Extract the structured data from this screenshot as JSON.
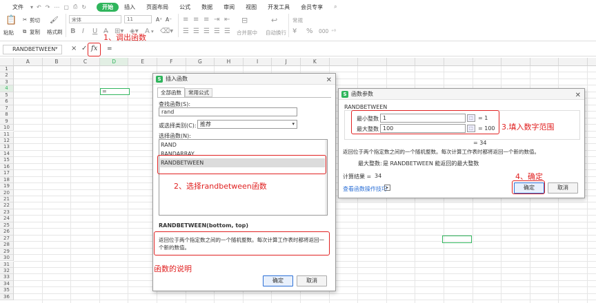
{
  "ribbon": {
    "menu": [
      "文件",
      "开始",
      "插入",
      "页面布局",
      "公式",
      "数据",
      "审阅",
      "视图",
      "开发工具",
      "会员专享"
    ],
    "cut": "剪切",
    "copy": "复制",
    "paste": "粘贴",
    "format_painter": "格式刷",
    "font_name": "宋体",
    "font_size": "11",
    "merge_center": "合并居中",
    "auto_wrap": "自动换行",
    "number_format": "常规",
    "percent": "%",
    "thousands": "000",
    "bold": "B",
    "italic": "I",
    "underline": "U",
    "font_color_glyph": "A"
  },
  "formula_bar": {
    "name_box": "RANDBETWEEN",
    "cancel": "×",
    "confirm": "✓",
    "fx": "fx",
    "content": "="
  },
  "grid": {
    "columns": [
      "A",
      "B",
      "C",
      "D",
      "E",
      "F",
      "G",
      "H",
      "I",
      "J",
      "K"
    ],
    "active_cell_value": "=",
    "active_row": "4",
    "active_col": "D"
  },
  "insert_dialog": {
    "title": "插入函数",
    "tab_all": "全部函数",
    "tab_common": "常用公式",
    "search_label": "查找函数(S):",
    "search_value": "rand",
    "category_label": "或选择类别(C):",
    "category_value": "推荐",
    "list_label": "选择函数(N):",
    "functions": [
      "RAND",
      "RANDARRAY",
      "RANDBETWEEN"
    ],
    "signature": "RANDBETWEEN(bottom, top)",
    "description": "返回位于两个指定数之间的一个随机整数。每次计算工作表时都将返回一个新的数值。",
    "ok": "确定",
    "cancel": "取消"
  },
  "args_dialog": {
    "title": "函数参数",
    "func_name": "RANDBETWEEN",
    "min_label": "最小整数",
    "min_value": "1",
    "min_result": "= 1",
    "max_label": "最大整数",
    "max_value": "100",
    "max_result": "= 100",
    "sample_result": "= 34",
    "description": "返回位于两个指定数之间的一个随机整数。每次计算工作表时都将返回一个新的数值。",
    "param_desc_label": "最大整数:",
    "param_desc": "是 RANDBETWEEN 能返回的最大整数",
    "calc_result_label": "计算结果 =",
    "calc_result_value": "34",
    "tips_link": "查看函数操作技巧",
    "ok": "确定",
    "cancel": "取消"
  },
  "annotations": {
    "step1": "1、调出函数",
    "step2": "2、选择randbetween函数",
    "step3": "3.填入数字范围",
    "step4": "4、确定",
    "desc_note": "函数的说明"
  },
  "colors": {
    "accent": "#2fb55c",
    "annotation": "#e02020",
    "selection": "#dcdcdc"
  }
}
